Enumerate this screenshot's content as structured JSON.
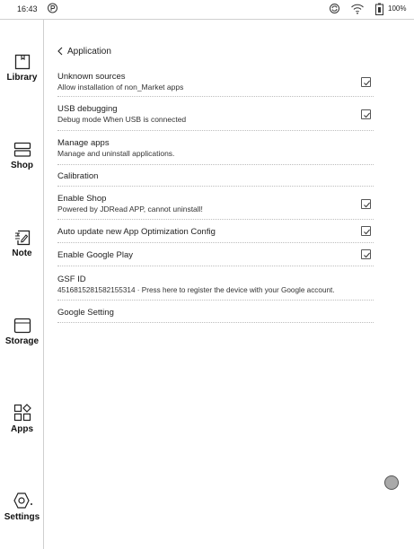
{
  "status_bar": {
    "time": "16:43",
    "battery": "100%",
    "icons": [
      "p-icon",
      "sync-icon",
      "wifi-icon",
      "battery-icon"
    ]
  },
  "sidebar": {
    "items": [
      {
        "label": "Library",
        "icon": "book-icon"
      },
      {
        "label": "Shop",
        "icon": "shop-icon"
      },
      {
        "label": "Note",
        "icon": "note-icon"
      },
      {
        "label": "Storage",
        "icon": "storage-icon"
      },
      {
        "label": "Apps",
        "icon": "apps-icon"
      },
      {
        "label": "Settings",
        "icon": "settings-icon"
      }
    ]
  },
  "header": {
    "back_label": "Application"
  },
  "settings": [
    {
      "title": "Unknown sources",
      "subtitle": "Allow installation of non_Market apps",
      "checked": true
    },
    {
      "title": "USB debugging",
      "subtitle": "Debug mode When USB is connected",
      "checked": true
    },
    {
      "title": "Manage apps",
      "subtitle": "Manage and uninstall applications."
    },
    {
      "title": "Calibration"
    },
    {
      "title": "Enable Shop",
      "subtitle": "Powered by JDRead APP, cannot uninstall!",
      "checked": true
    },
    {
      "title": "Auto update new App Optimization Config",
      "checked": true
    },
    {
      "title": "Enable Google Play",
      "checked": true
    },
    {
      "title": "GSF ID",
      "subtitle": "4516815281582155314 · Press here to register the device with your Google account."
    },
    {
      "title": "Google Setting"
    }
  ]
}
